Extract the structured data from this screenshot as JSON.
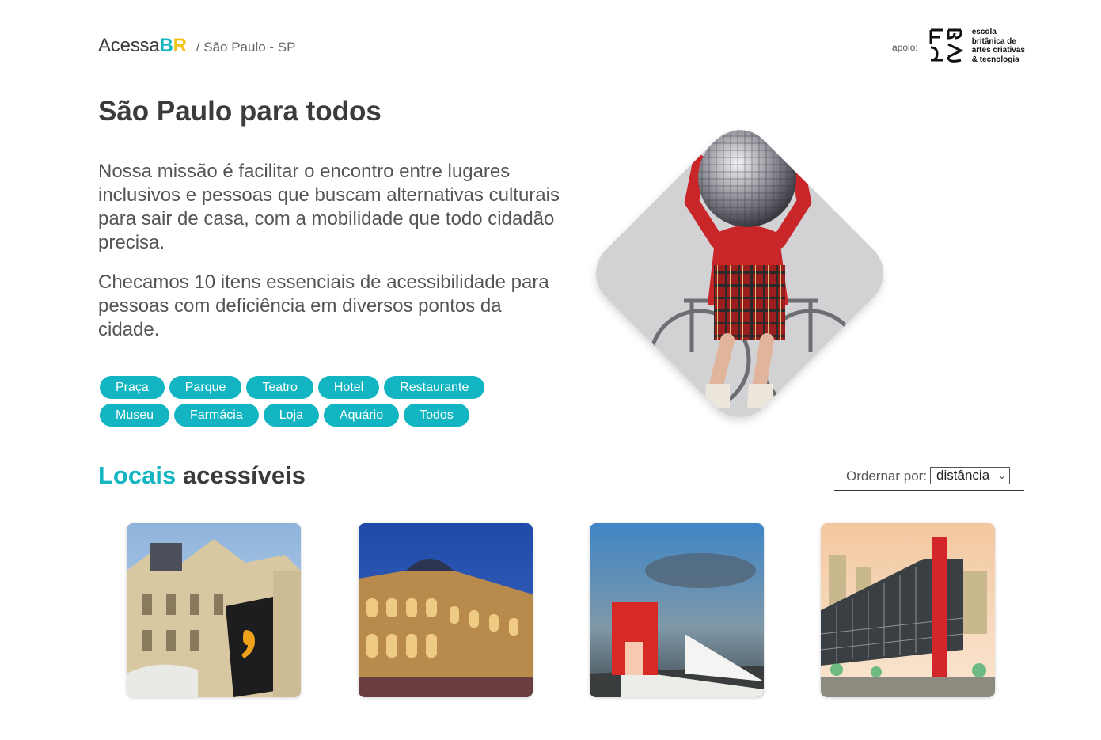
{
  "header": {
    "logo_text": "Acessa",
    "logo_b": "B",
    "logo_r": "R",
    "location": "/ São Paulo - SP",
    "support_label": "apoio:",
    "sponsor_lines": [
      "escola",
      "britânica de",
      "artes criativas",
      "& tecnologia"
    ]
  },
  "hero": {
    "title": "São Paulo para todos",
    "paragraph1": "Nossa missão é facilitar o encontro entre lugares inclusivos e pessoas que buscam alternativas culturais para sair de casa, com a mobilidade que todo cidadão precisa.",
    "paragraph2": "Checamos 10 itens essenciais de acessibilidade para pessoas com deficiência em diversos pontos da cidade."
  },
  "categories": [
    "Praça",
    "Parque",
    "Teatro",
    "Hotel",
    "Restaurante",
    "Museu",
    "Farmácia",
    "Loja",
    "Aquário",
    "Todos"
  ],
  "places": {
    "title_accent": "Locais",
    "title_rest": "acessíveis",
    "sort_label": "Ordernar por:",
    "sort_value": "distância"
  },
  "colors": {
    "accent": "#12b5c1",
    "logo_r": "#f3c316",
    "heading": "#3b3b3b",
    "body_text": "#555555"
  },
  "icons": {
    "sort_select": "chevron-down-icon",
    "sponsor": "ebac-logo-icon"
  }
}
